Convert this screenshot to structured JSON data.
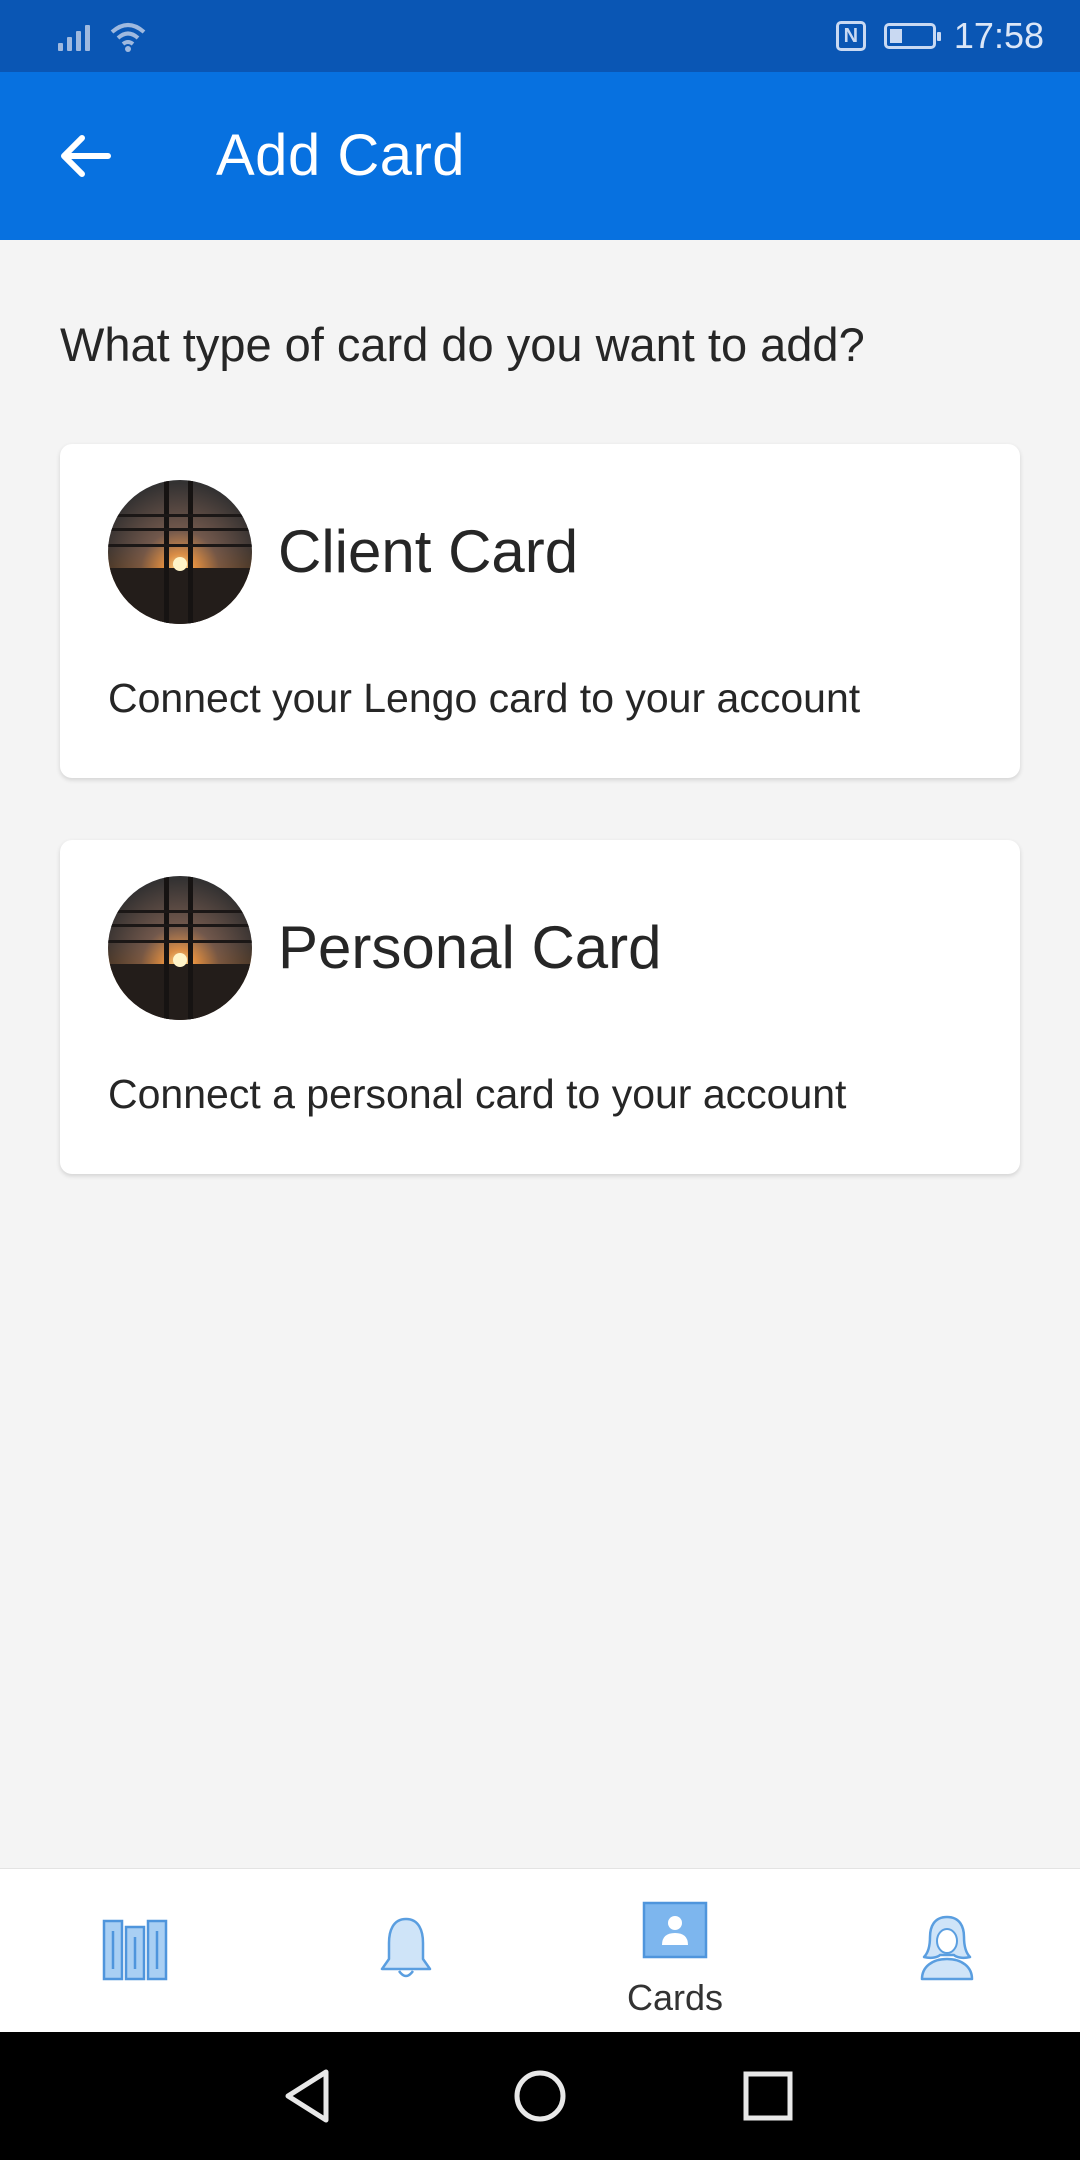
{
  "status_bar": {
    "time": "17:58",
    "icons": [
      "signal-icon",
      "wifi-icon",
      "nfc-icon",
      "battery-icon"
    ]
  },
  "app_bar": {
    "title": "Add Card",
    "back_icon": "arrow-left-icon",
    "color": "#0771e0"
  },
  "content": {
    "question": "What type of card do you want to add?",
    "cards": [
      {
        "title": "Client Card",
        "description": "Connect your Lengo card to your account",
        "image": "sunset-window-photo"
      },
      {
        "title": "Personal Card",
        "description": "Connect a personal card to your account",
        "image": "sunset-window-photo"
      }
    ]
  },
  "bottom_nav": {
    "items": [
      {
        "icon": "books-icon",
        "label": ""
      },
      {
        "icon": "bell-icon",
        "label": ""
      },
      {
        "icon": "cards-icon",
        "label": "Cards",
        "active": true
      },
      {
        "icon": "profile-icon",
        "label": ""
      }
    ],
    "accent": "#6aa9e8"
  },
  "system_nav": {
    "icons": [
      "back-triangle-icon",
      "home-circle-icon",
      "recents-square-icon"
    ]
  }
}
